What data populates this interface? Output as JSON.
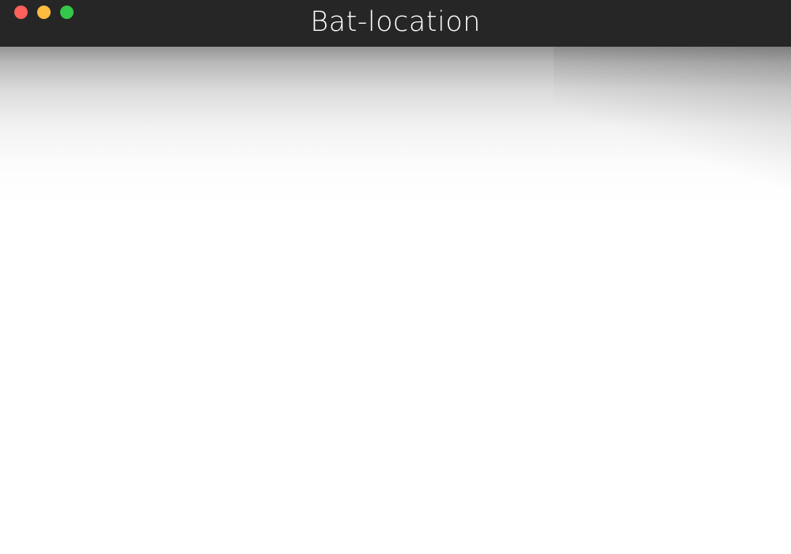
{
  "window": {
    "title": "Bat-location"
  },
  "colors": {
    "titlebar": "#262626",
    "close": "#fc605b",
    "minimize": "#fdbc40",
    "maximize": "#34c84a",
    "content_background": "#ffffff"
  },
  "icons": {
    "close": "close-icon",
    "minimize": "minimize-icon",
    "maximize": "maximize-icon"
  }
}
